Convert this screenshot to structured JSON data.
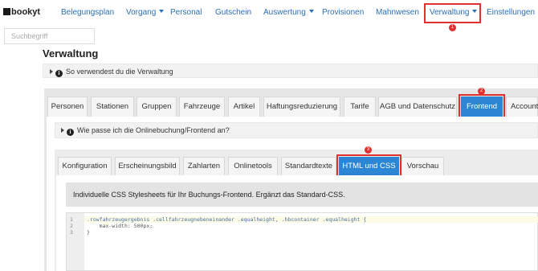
{
  "brand": {
    "name": "bookyt"
  },
  "nav": {
    "items": [
      "Belegungsplan",
      "Vorgang",
      "Personal",
      "Gutschein",
      "Auswertung",
      "Provisionen",
      "Mahnwesen",
      "Verwaltung",
      "Einstellungen"
    ]
  },
  "search": {
    "placeholder": "Suchbegriff"
  },
  "page": {
    "title": "Verwaltung",
    "help1": "So verwendest du die Verwaltung",
    "help2": "Wie passe ich die Onlinebuchung/Frontend an?",
    "description": "Individuelle CSS Stylesheets für Ihr Buchungs-Frontend. Ergänzt das Standard-CSS."
  },
  "main_tabs": [
    "Personen",
    "Stationen",
    "Gruppen",
    "Fahrzeuge",
    "Artikel",
    "Haftungsreduzierung",
    "Tarife",
    "AGB und Datenschutz",
    "Frontend",
    "Account"
  ],
  "sub_tabs": [
    "Konfiguration",
    "Erscheinungsbild",
    "Zahlarten",
    "Onlinetools",
    "Standardtexte",
    "HTML und CSS",
    "Vorschau"
  ],
  "markers": [
    "1",
    "2",
    "3"
  ],
  "editor": {
    "line_numbers": [
      "1",
      "2",
      "3"
    ],
    "lines": [
      ".rowfahrzeugergebnis .cellfahrzeugnebeneinander .equalheight, .hbcontainer .equalheight {",
      "    max-width: 500px;",
      "}"
    ]
  },
  "colors": {
    "accent": "#2c86d4",
    "link": "#2c6fb3",
    "highlight": "#e03030"
  }
}
